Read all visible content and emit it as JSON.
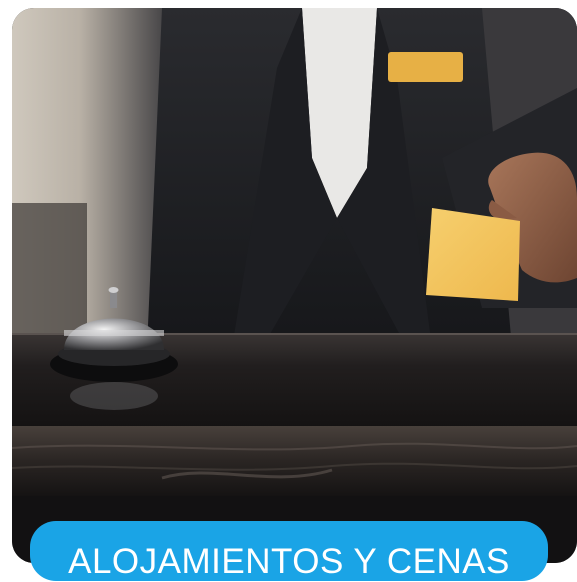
{
  "promo": {
    "image_alt": "Recepcionista de hotel entregando una tarjeta llave junto a un timbre de mostrador",
    "cta_label": "ALOJAMIENTOS Y CENAS",
    "cta_color": "#1aa4e6",
    "card_color": "#f2c35a"
  }
}
